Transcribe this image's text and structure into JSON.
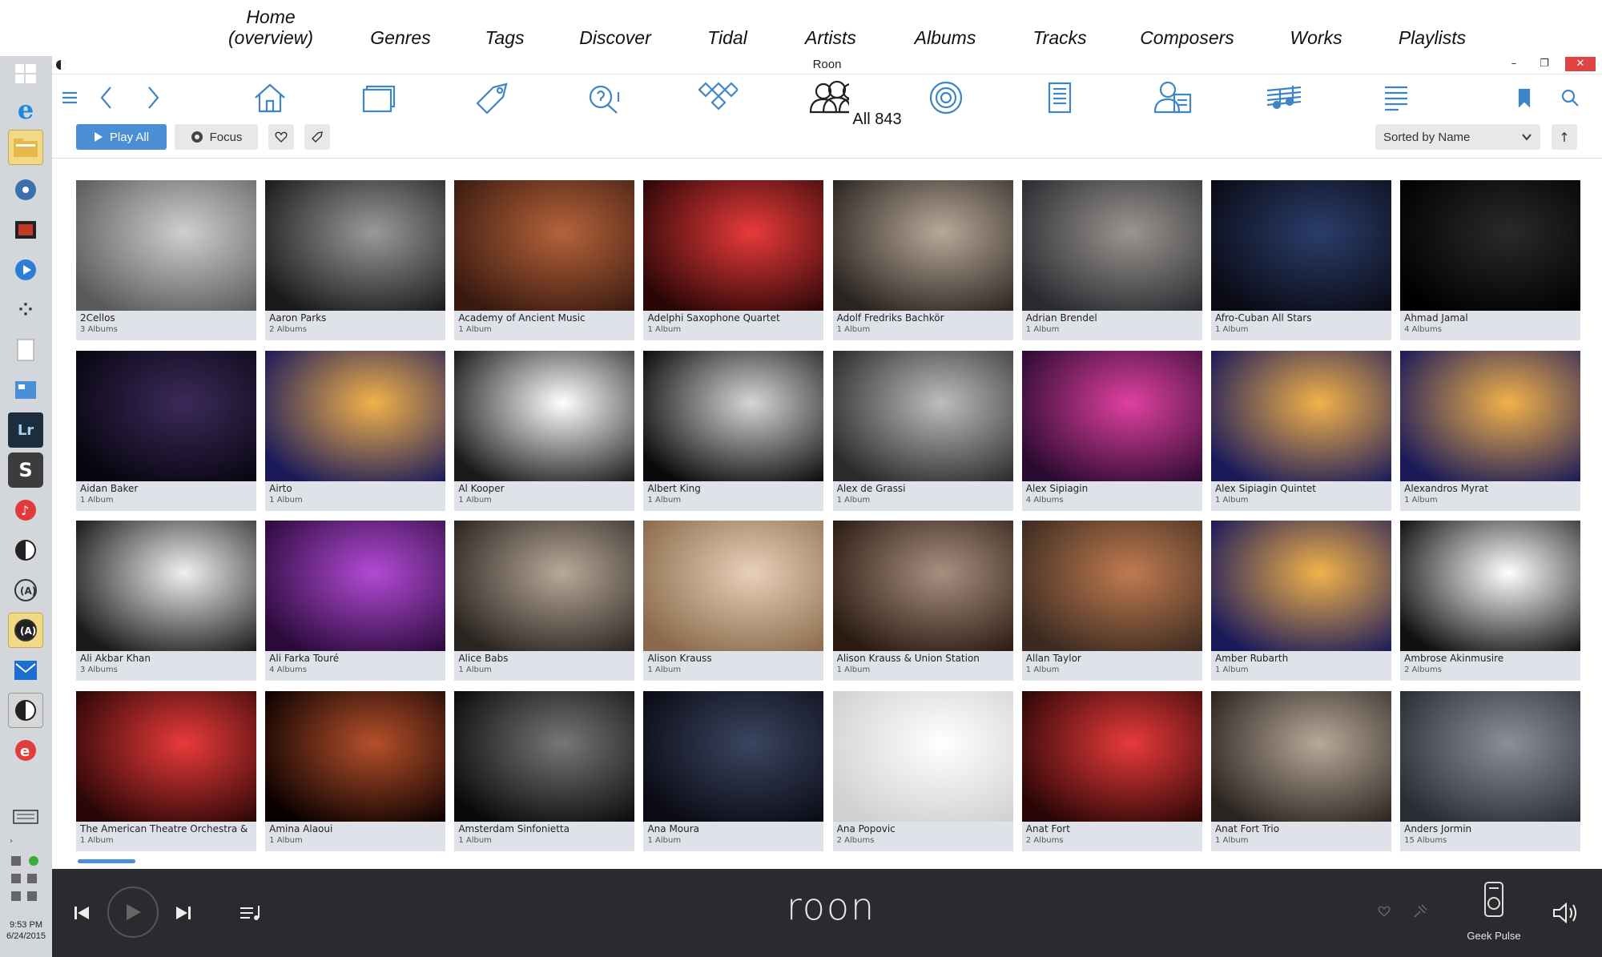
{
  "annotations": [
    "Home\n(overview)",
    "Genres",
    "Tags",
    "Discover",
    "Tidal",
    "Artists",
    "Albums",
    "Tracks",
    "Composers",
    "Works",
    "Playlists"
  ],
  "window": {
    "title": "Roon"
  },
  "header": {
    "all_count": "All 843"
  },
  "actions": {
    "play_all": "Play All",
    "focus": "Focus",
    "sort": "Sorted by Name"
  },
  "taskbar": {
    "clock_time": "9:53 PM",
    "clock_date": "6/24/2015"
  },
  "player": {
    "logo": "roon",
    "zone": "Geek Pulse"
  },
  "artists": [
    {
      "name": "2Cellos",
      "count": "3 Albums"
    },
    {
      "name": "Aaron Parks",
      "count": "2 Albums"
    },
    {
      "name": "Academy of Ancient Music",
      "count": "1 Album"
    },
    {
      "name": "Adelphi Saxophone Quartet",
      "count": "1 Album"
    },
    {
      "name": "Adolf Fredriks Bachkör",
      "count": "1 Album"
    },
    {
      "name": "Adrian Brendel",
      "count": "1 Album"
    },
    {
      "name": "Afro-Cuban All Stars",
      "count": "1 Album"
    },
    {
      "name": "Ahmad Jamal",
      "count": "4 Albums"
    },
    {
      "name": "Aidan Baker",
      "count": "1 Album"
    },
    {
      "name": "Airto",
      "count": "1 Album"
    },
    {
      "name": "Al Kooper",
      "count": "1 Album"
    },
    {
      "name": "Albert King",
      "count": "1 Album"
    },
    {
      "name": "Alex de Grassi",
      "count": "1 Album"
    },
    {
      "name": "Alex Sipiagin",
      "count": "4 Albums"
    },
    {
      "name": "Alex Sipiagin Quintet",
      "count": "1 Album"
    },
    {
      "name": "Alexandros Myrat",
      "count": "1 Album"
    },
    {
      "name": "Ali Akbar Khan",
      "count": "3 Albums"
    },
    {
      "name": "Ali Farka Touré",
      "count": "4 Albums"
    },
    {
      "name": "Alice Babs",
      "count": "1 Album"
    },
    {
      "name": "Alison Krauss",
      "count": "1 Album"
    },
    {
      "name": "Alison Krauss & Union Station",
      "count": "1 Album"
    },
    {
      "name": "Allan Taylor",
      "count": "1 Album"
    },
    {
      "name": "Amber Rubarth",
      "count": "1 Album"
    },
    {
      "name": "Ambrose Akinmusire",
      "count": "2 Albums"
    },
    {
      "name": "The American Theatre Orchestra &",
      "count": "1 Album"
    },
    {
      "name": "Amina Alaoui",
      "count": "1 Album"
    },
    {
      "name": "Amsterdam Sinfonietta",
      "count": "1 Album"
    },
    {
      "name": "Ana Moura",
      "count": "1 Album"
    },
    {
      "name": "Ana Popovic",
      "count": "2 Albums"
    },
    {
      "name": "Anat Fort",
      "count": "2 Albums"
    },
    {
      "name": "Anat Fort Trio",
      "count": "1 Album"
    },
    {
      "name": "Anders Jormin",
      "count": "15 Albums"
    }
  ]
}
